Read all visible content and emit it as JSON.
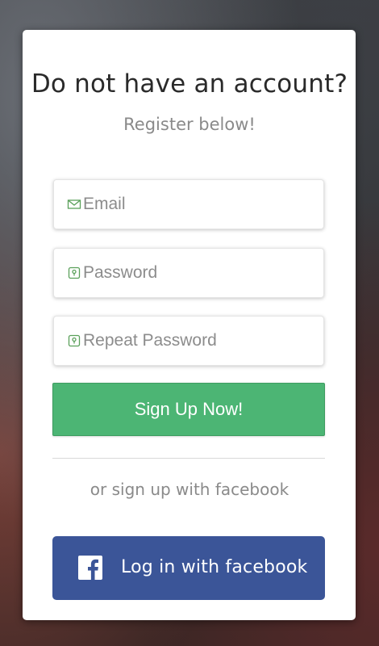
{
  "header": {
    "title": "Do not have an account?",
    "subtitle": "Register below!"
  },
  "form": {
    "email": {
      "placeholder": "Email",
      "icon": "envelope-icon"
    },
    "password": {
      "placeholder": "Password",
      "icon": "lock-icon"
    },
    "repeat_password": {
      "placeholder": "Repeat Password",
      "icon": "lock-icon"
    },
    "submit_label": "Sign Up Now!"
  },
  "alternate": {
    "text": "or sign up with facebook",
    "facebook_button_label": "Log in with facebook",
    "facebook_icon": "facebook-icon"
  },
  "colors": {
    "accent_green": "#4cb574",
    "facebook_blue": "#3b5598",
    "icon_green": "#5aa05a"
  }
}
